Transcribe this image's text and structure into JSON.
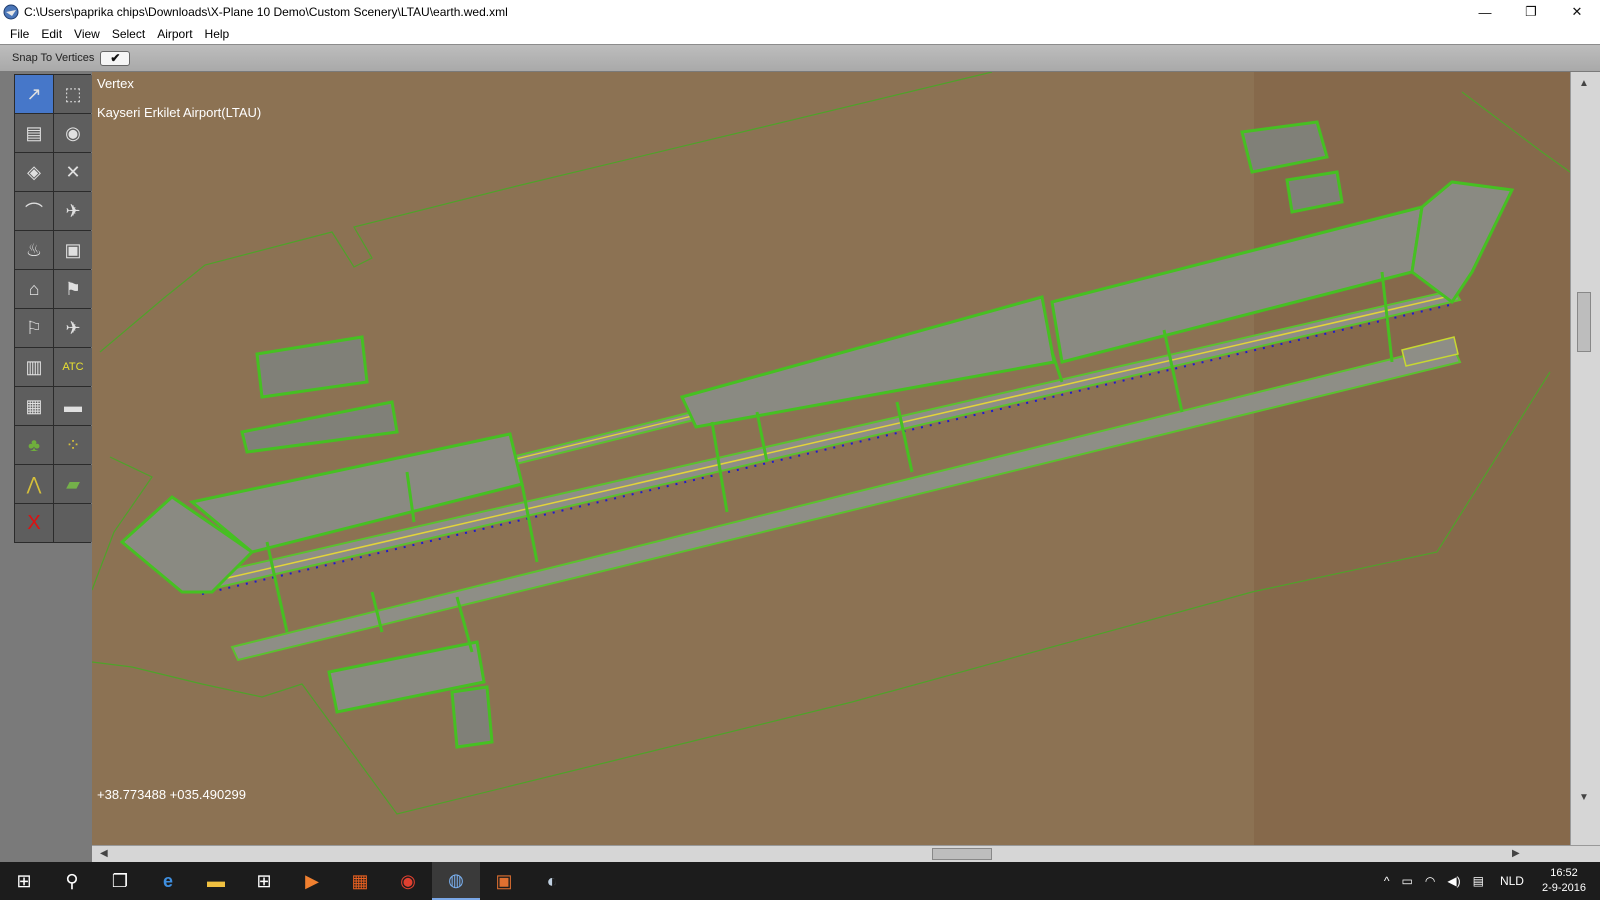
{
  "window": {
    "title": "C:\\Users\\paprika chips\\Downloads\\X-Plane 10 Demo\\Custom Scenery\\LTAU\\earth.wed.xml",
    "minimize": "—",
    "restore": "❐",
    "close": "✕"
  },
  "menu": [
    "File",
    "Edit",
    "View",
    "Select",
    "Airport",
    "Help"
  ],
  "snap": {
    "label": "Snap To Vertices",
    "checked": "✔"
  },
  "tools": [
    {
      "name": "vertex-tool",
      "glyph": "↗"
    },
    {
      "name": "marquee-tool",
      "glyph": "⬚"
    },
    {
      "name": "runway-tool",
      "glyph": "▤"
    },
    {
      "name": "helipad-tool",
      "glyph": "◉"
    },
    {
      "name": "taxiway-tool",
      "glyph": "◈"
    },
    {
      "name": "boundary-tool",
      "glyph": "✕"
    },
    {
      "name": "taxiline-tool",
      "glyph": "⌒"
    },
    {
      "name": "ramp-start-tool",
      "glyph": "✈"
    },
    {
      "name": "light-fixture-tool",
      "glyph": "♨"
    },
    {
      "name": "sign-tool",
      "glyph": "▣"
    },
    {
      "name": "tower-viewpoint-tool",
      "glyph": "⌂"
    },
    {
      "name": "windsock-tool",
      "glyph": "⚑"
    },
    {
      "name": "beacon-tool",
      "glyph": "⚐"
    },
    {
      "name": "atc-flow-tool",
      "glyph": "✈"
    },
    {
      "name": "facade-tool",
      "glyph": "▥"
    },
    {
      "name": "atc-tool",
      "glyph": "ATC"
    },
    {
      "name": "object-tool",
      "glyph": "▦"
    },
    {
      "name": "object-string-tool",
      "glyph": "▬"
    },
    {
      "name": "forest-tool",
      "glyph": "♣"
    },
    {
      "name": "line-tool",
      "glyph": "⁘"
    },
    {
      "name": "polygon-line-tool",
      "glyph": "⋀"
    },
    {
      "name": "draped-polygon-tool",
      "glyph": "▰"
    },
    {
      "name": "exclusion-tool",
      "glyph": "X"
    },
    {
      "name": "empty-tool",
      "glyph": ""
    }
  ],
  "map": {
    "mode": "Vertex",
    "airport": "Kayseri Erkilet Airport(LTAU)",
    "coords": "+38.773488 +035.490299"
  },
  "taskbar": {
    "items": [
      {
        "name": "start",
        "glyph": "⊞"
      },
      {
        "name": "search",
        "glyph": "⚲"
      },
      {
        "name": "task-view",
        "glyph": "❐"
      },
      {
        "name": "edge",
        "glyph": "e"
      },
      {
        "name": "file-explorer",
        "glyph": "▬"
      },
      {
        "name": "store",
        "glyph": "⊞"
      },
      {
        "name": "media-player",
        "glyph": "▶"
      },
      {
        "name": "office",
        "glyph": "▦"
      },
      {
        "name": "chrome",
        "glyph": "◉"
      },
      {
        "name": "world-editor",
        "glyph": "◍"
      },
      {
        "name": "photos",
        "glyph": "▣"
      },
      {
        "name": "paint",
        "glyph": "◐"
      }
    ],
    "tray": {
      "chevron": "^",
      "battery": "▭",
      "wifi": "◠",
      "volume": "◀)",
      "notifications": "▤",
      "language": "NLD",
      "time": "16:52",
      "date": "2-9-2016"
    }
  }
}
